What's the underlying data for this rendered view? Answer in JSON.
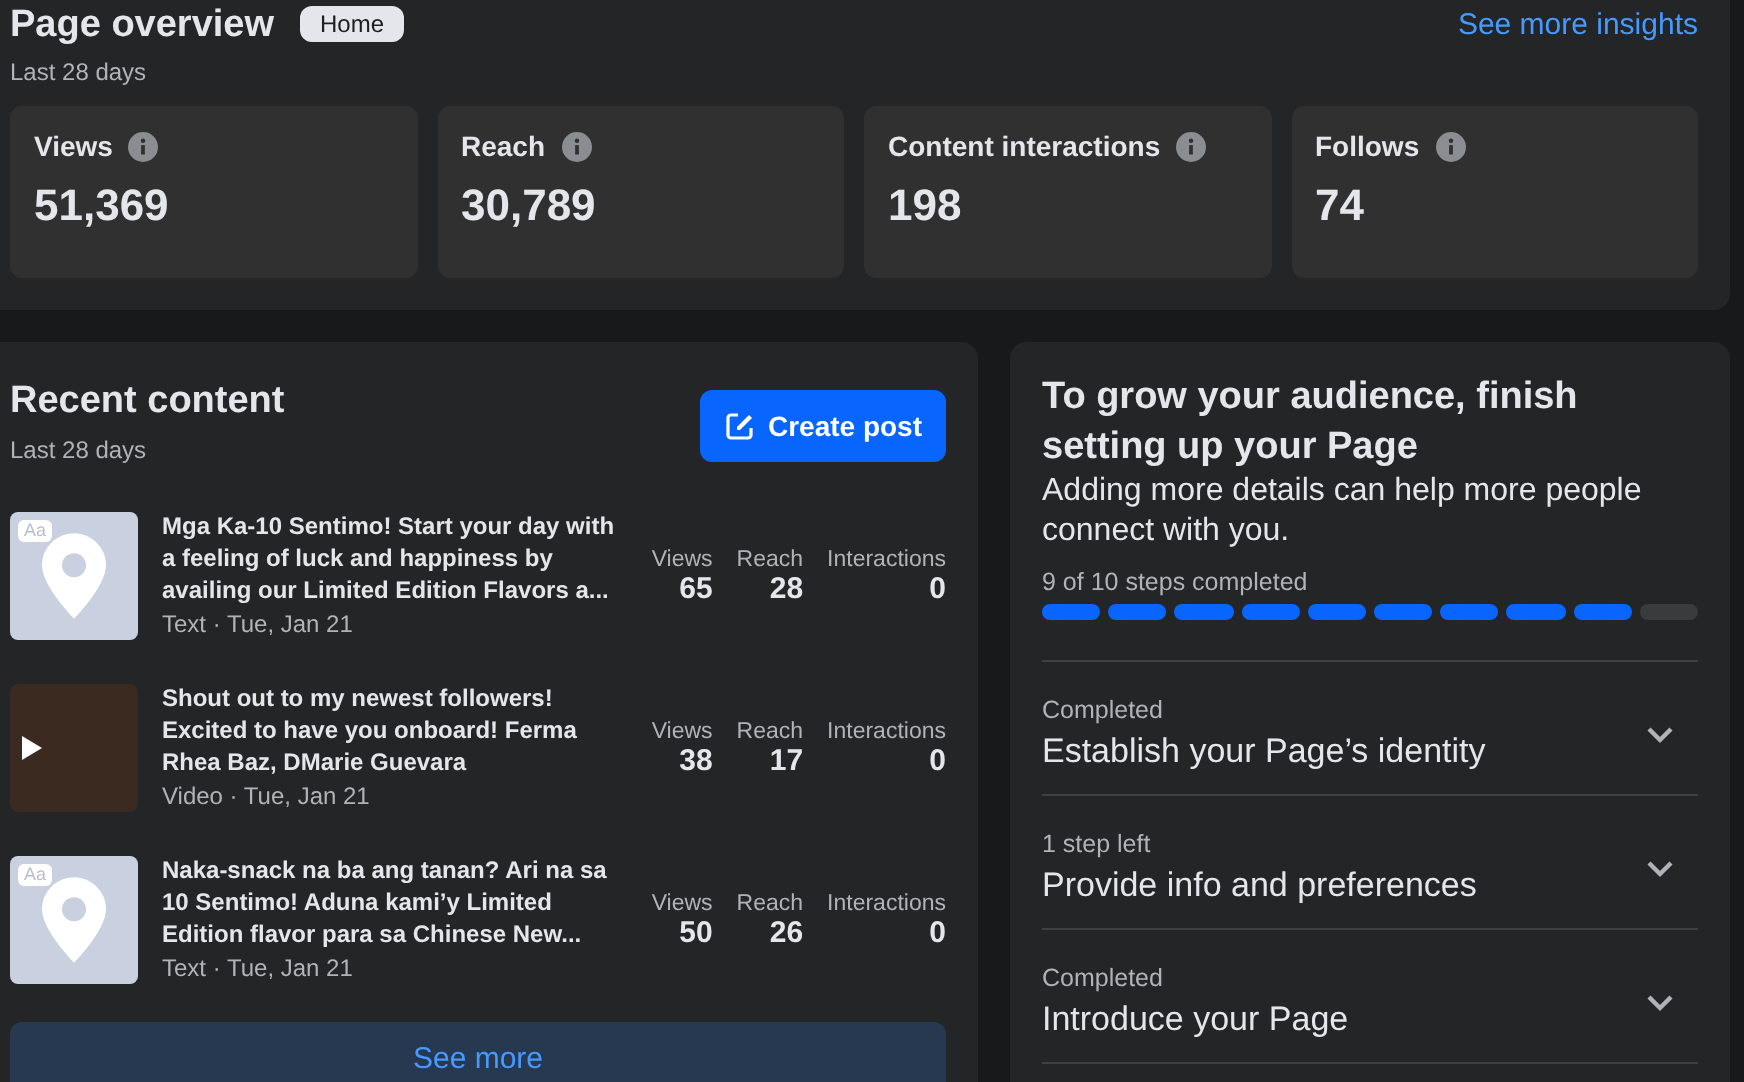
{
  "tooltip": "Home",
  "overview": {
    "title": "Page overview",
    "subtitle": "Last 28 days",
    "link": "See more insights",
    "stats": [
      {
        "label": "Views",
        "value": "51,369"
      },
      {
        "label": "Reach",
        "value": "30,789"
      },
      {
        "label": "Content interactions",
        "value": "198"
      },
      {
        "label": "Follows",
        "value": "74"
      }
    ]
  },
  "recent": {
    "title": "Recent content",
    "subtitle": "Last 28 days",
    "button": "Create post",
    "more": "See more",
    "posts": [
      {
        "kind": "text",
        "thumb_label": "Aa",
        "title": "Mga Ka-10 Sentimo! Start your day with a feeling of luck and happiness by availing our Limited Edition Flavors a...",
        "meta": "Text · Tue, Jan 21",
        "metrics": [
          {
            "label": "Views",
            "value": "65"
          },
          {
            "label": "Reach",
            "value": "28"
          },
          {
            "label": "Interactions",
            "value": "0"
          }
        ]
      },
      {
        "kind": "video",
        "title": "Shout out to my newest followers! Excited to have you onboard! Ferma Rhea Baz, DMarie Guevara",
        "meta": "Video · Tue, Jan 21",
        "metrics": [
          {
            "label": "Views",
            "value": "38"
          },
          {
            "label": "Reach",
            "value": "17"
          },
          {
            "label": "Interactions",
            "value": "0"
          }
        ]
      },
      {
        "kind": "text",
        "thumb_label": "Aa",
        "title": "Naka-snack na ba ang tanan? Ari na sa 10 Sentimo! Aduna kami’y Limited Edition flavor para sa Chinese New...",
        "meta": "Text · Tue, Jan 21",
        "metrics": [
          {
            "label": "Views",
            "value": "50"
          },
          {
            "label": "Reach",
            "value": "26"
          },
          {
            "label": "Interactions",
            "value": "0"
          }
        ]
      }
    ]
  },
  "setup": {
    "title": "To grow your audience, finish setting up your Page",
    "description": "Adding more details can help more people connect with you.",
    "progress_label": "9 of 10 steps completed",
    "progress_segments": [
      {
        "completed": true
      },
      {
        "completed": true
      },
      {
        "completed": true
      },
      {
        "completed": true
      },
      {
        "completed": true
      },
      {
        "completed": true
      },
      {
        "completed": true
      },
      {
        "completed": true
      },
      {
        "completed": true
      },
      {
        "completed": false
      }
    ],
    "sections": [
      {
        "status": "Completed",
        "title": "Establish your Page’s identity",
        "expanded": false
      },
      {
        "status": "1 step left",
        "title": "Provide info and preferences",
        "expanded": false
      },
      {
        "status": "Completed",
        "title": "Introduce your Page",
        "expanded": false
      }
    ]
  }
}
